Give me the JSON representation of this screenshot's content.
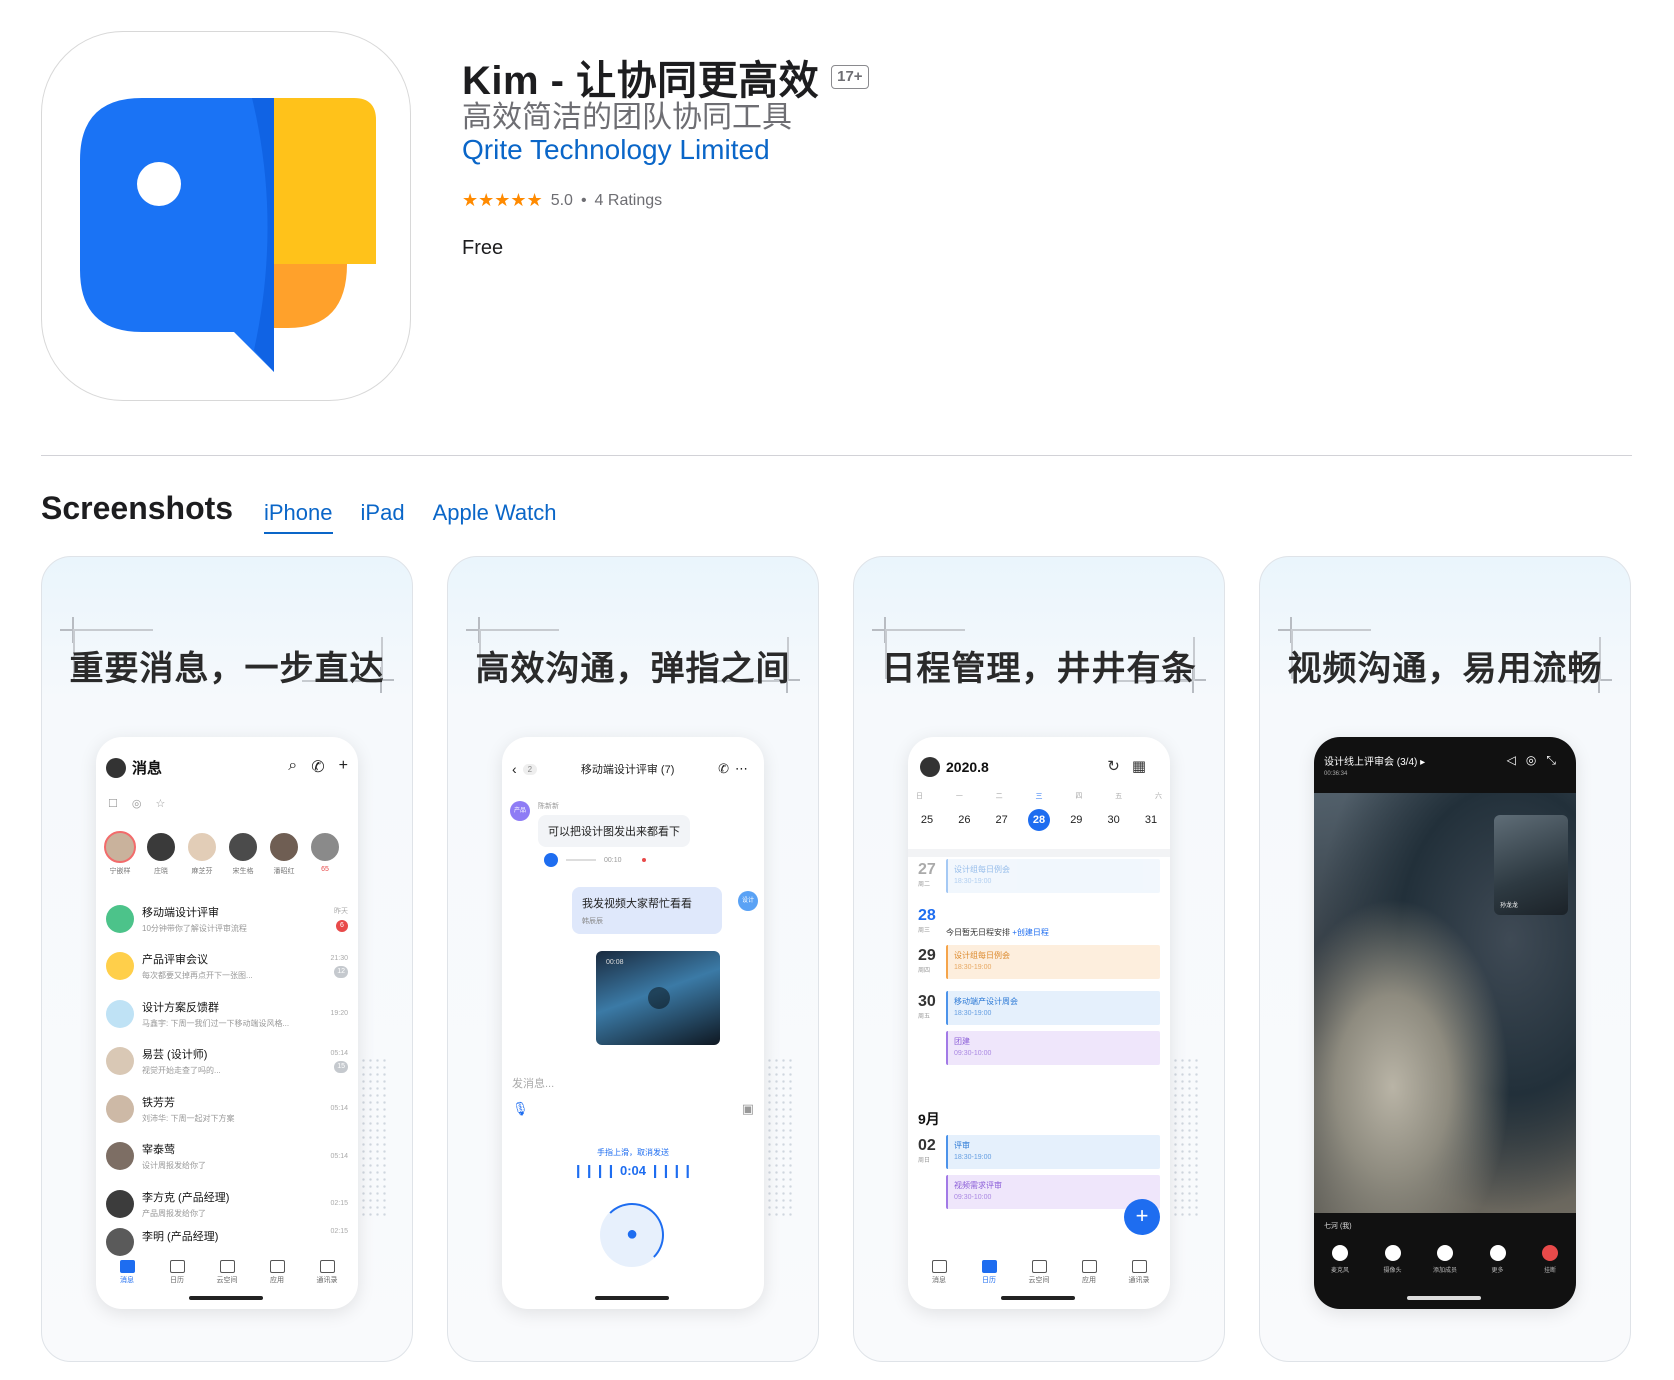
{
  "app": {
    "title": "Kim - 让协同更高效",
    "age_rating": "17+",
    "subtitle": "高效简洁的团队协同工具",
    "developer": "Qrite Technology Limited",
    "stars": "★★★★★",
    "rating": "5.0",
    "separator": "•",
    "rating_count": "4 Ratings",
    "price": "Free",
    "colors": {
      "icon_blue": "#1a73f5",
      "icon_yellow": "#ffc21a",
      "icon_orange": "#ffa12b",
      "link": "#0a66c8"
    }
  },
  "screenshots": {
    "heading": "Screenshots",
    "tabs": [
      {
        "label": "iPhone",
        "active": true
      },
      {
        "label": "iPad",
        "active": false
      },
      {
        "label": "Apple Watch",
        "active": false
      }
    ],
    "cards": [
      {
        "headline": "重要消息，一步直达",
        "screen": {
          "title": "消息",
          "filters": [
            "☐",
            "◎",
            "☆"
          ],
          "stories": [
            "宁嵌样",
            "庄晓",
            "麻芝芬",
            "宋生格",
            "潘昭红",
            "65"
          ],
          "conversations": [
            {
              "name": "移动端设计评审",
              "preview": "10分钟带你了解设计评审流程",
              "time": "昨天",
              "badge": "6"
            },
            {
              "name": "产品评审会议",
              "preview": "每次都要又掉再点开下一张图...",
              "time": "21:30",
              "badge": "12"
            },
            {
              "name": "设计方案反馈群",
              "preview": "马鑫宇: 下周一我们过一下移动端设风格...",
              "time": "19:20",
              "badge": ""
            },
            {
              "name": "易芸 (设计师)",
              "preview": "视觉开始走查了吗的...",
              "time": "05:14",
              "badge": "15"
            },
            {
              "name": "铁芳芳",
              "preview": "刘沛华: 下周一起对下方案",
              "time": "05:14",
              "badge": ""
            },
            {
              "name": "宰泰莺",
              "preview": "设计周报发给你了",
              "time": "05:14",
              "badge": ""
            },
            {
              "name": "李方克 (产品经理)",
              "preview": "产品周报发给你了",
              "time": "02:15",
              "badge": ""
            },
            {
              "name": "李明 (产品经理)",
              "preview": "",
              "time": "02:15",
              "badge": ""
            }
          ],
          "tabbar": [
            "消息",
            "日历",
            "云空间",
            "应用",
            "通讯录"
          ]
        }
      },
      {
        "headline": "高效沟通，弹指之间",
        "screen": {
          "back_count": "2",
          "title": "移动端设计评审 (7)",
          "sender_avatar": "产品",
          "sender_name": "陈新新",
          "message": "可以把设计图发出来都看下",
          "voice_time": "00:10",
          "my_message": "我发视频大家帮忙看看",
          "my_sub": "韩辰辰",
          "design_avatar": "设计",
          "video_time": "00:08",
          "input_placeholder": "发消息...",
          "hint": "手指上滑，取消发送",
          "timer": "❙❙❙❙ 0:04 ❙❙❙❙"
        }
      },
      {
        "headline": "日程管理，井井有条",
        "screen": {
          "month": "2020.8",
          "weekdays": [
            "日",
            "一",
            "二",
            "三",
            "四",
            "五",
            "六"
          ],
          "dates": [
            "25",
            "26",
            "27",
            "28",
            "29",
            "30",
            "31"
          ],
          "selected_date": "28",
          "days": [
            {
              "date": "27",
              "weekday": "周二"
            },
            {
              "date": "28",
              "weekday": "周三"
            },
            {
              "date": "29",
              "weekday": "周四"
            },
            {
              "date": "30",
              "weekday": "周五"
            },
            {
              "date": "02",
              "weekday": "周日"
            }
          ],
          "events": [
            {
              "name": "设计组每日例会",
              "time": "18:30-19:00"
            },
            {
              "name": "设计组每日例会",
              "time": "18:30-19:00"
            },
            {
              "name": "移动端产设计周会",
              "time": "18:30-19:00"
            },
            {
              "name": "团建",
              "time": "09:30-10:00"
            },
            {
              "name": "评审",
              "time": "18:30-19:00"
            },
            {
              "name": "视频需求评审",
              "time": "09:30-10:00"
            }
          ],
          "no_event": "今日暂无日程安排",
          "create_event": "+创建日程",
          "next_month": "9月",
          "fab": "+"
        }
      },
      {
        "headline": "视频沟通，易用流畅",
        "screen": {
          "title": "设计线上评审会 (3/4) ▸",
          "elapsed": "00:36:34",
          "pip_name": "孙龙龙",
          "self_name": "七河 (我)",
          "controls": [
            "麦克风",
            "摄像头",
            "添加成员",
            "更多",
            "挂断"
          ]
        }
      }
    ]
  }
}
